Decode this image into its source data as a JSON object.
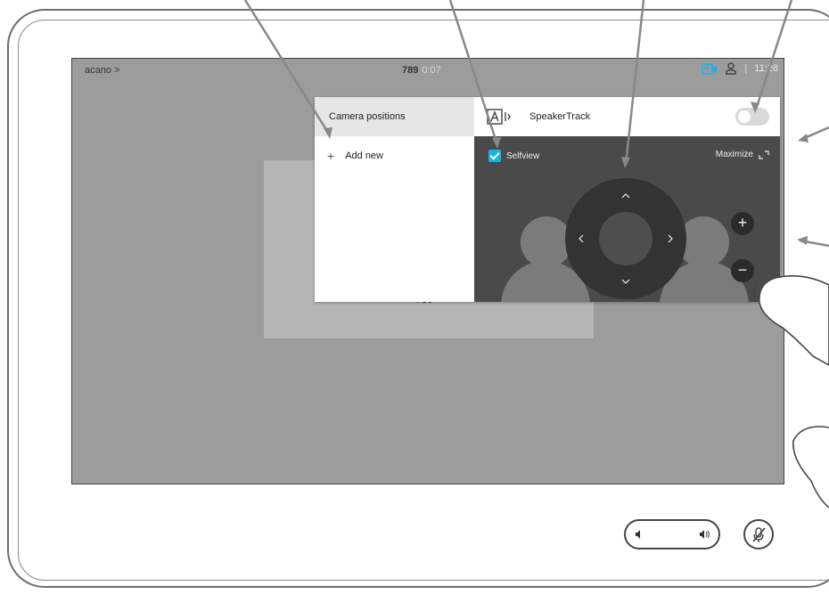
{
  "status_bar": {
    "system_name": "acano >",
    "call_number": "789",
    "call_duration": "0:07",
    "clock": "11:28",
    "separator": "|"
  },
  "preview": {
    "remote_number": "789"
  },
  "camera_panel": {
    "left": {
      "heading": "Camera positions",
      "add_label": "Add new",
      "add_icon": "+"
    },
    "speakertrack": {
      "label": "SpeakerTrack",
      "enabled": false
    },
    "selfview": {
      "label": "Selfview",
      "checked": true
    },
    "maximize_label": "Maximize",
    "zoom_in": "+",
    "zoom_out": "−",
    "accent_color": "#18b3e6"
  },
  "icons": [
    "camera-icon",
    "person-icon",
    "speakertrack-icon",
    "checkbox-icon",
    "maximize-icon",
    "chevron-up-icon",
    "chevron-down-icon",
    "chevron-left-icon",
    "chevron-right-icon",
    "volume-down-icon",
    "volume-up-icon",
    "mute-icon"
  ]
}
